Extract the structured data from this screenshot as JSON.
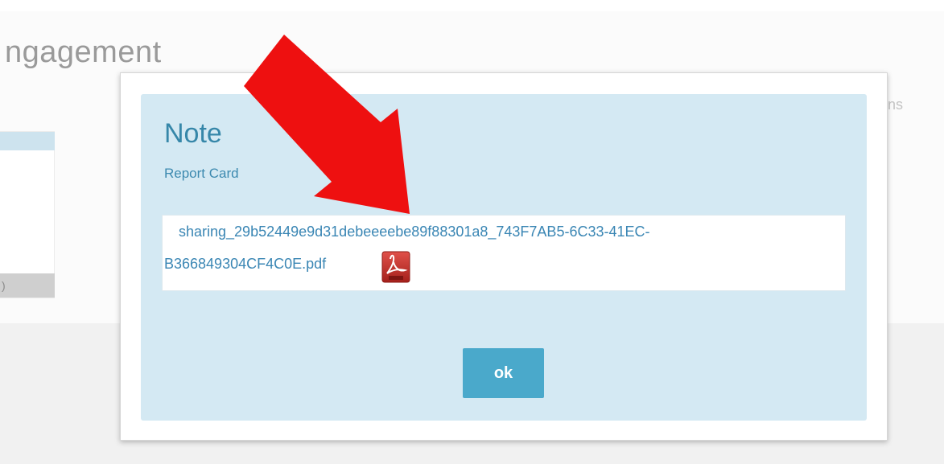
{
  "background": {
    "title_fragment": "ngagement",
    "right_fragment": "ns",
    "left_button_fragment": ")"
  },
  "modal": {
    "title": "Note",
    "subtitle": "Report Card",
    "attachment": {
      "line1": "sharing_29b52449e9d31debeeeebe89f88301a8_743F7AB5-6C33-41EC-",
      "line2": "B366849304CF4C0E.pdf",
      "icon": "pdf-file-icon"
    },
    "ok_label": "ok"
  },
  "colors": {
    "panel": "#d4e9f3",
    "title": "#3687a9",
    "link": "#3a86b4",
    "ok_button": "#4aa9cb",
    "arrow": "#ee1010",
    "pdf_icon": "#c9302c"
  },
  "annotation": {
    "icon": "red-arrow"
  }
}
